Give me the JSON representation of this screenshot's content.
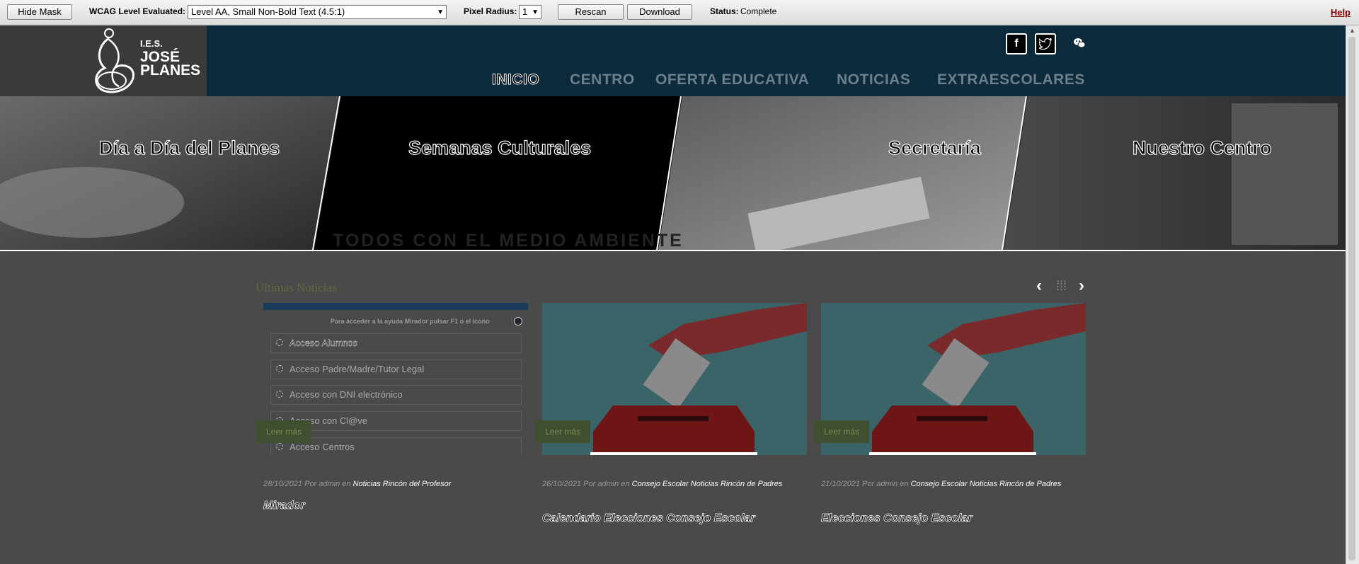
{
  "toolbar": {
    "hide_mask": "Hide Mask",
    "wcag_label": "WCAG Level Evaluated:",
    "wcag_value": "Level AA, Small Non-Bold Text (4.5:1)",
    "radius_label": "Pixel Radius:",
    "radius_value": "1",
    "rescan": "Rescan",
    "download": "Download",
    "status_label": "Status:",
    "status_value": "Complete",
    "help": "Help"
  },
  "header": {
    "logo_line1": "I.E.S.",
    "logo_line2": "JOSÉ",
    "logo_line3": "PLANES",
    "social": [
      "facebook-icon",
      "twitter-icon",
      "wechat-icon"
    ],
    "nav": [
      "INICIO",
      "CENTRO",
      "OFERTA EDUCATIVA",
      "NOTICIAS",
      "EXTRAESCOLARES"
    ]
  },
  "banner": {
    "panels": [
      "Día a Día del Planes",
      "Semanas Culturales",
      "Secretaría",
      "Nuestro Centro"
    ],
    "overlay_text": "TODOS CON EL MEDIO AMBIENTE"
  },
  "news": {
    "title": "Últimas Noticias",
    "login_help": "Para acceder a la ayuda Mirador pulsar F1 o el icono",
    "login_items": [
      "Acceso Alumnos",
      "Acceso Padre/Madre/Tutor Legal",
      "Acceso con DNI electrónico",
      "Acceso con Cl@ve",
      "Acceso Centros"
    ],
    "read_more": "Leer más",
    "cards": [
      {
        "meta": "28/10/2021 Por admin en",
        "categories": "Noticias Rincón del Profesor",
        "title": "Mirador"
      },
      {
        "meta": "26/10/2021 Por admin en",
        "categories": "Consejo Escolar Noticias Rincón de Padres",
        "title": "Calendario Elecciones Consejo Escolar"
      },
      {
        "meta": "21/10/2021 Por admin en",
        "categories": "Consejo Escolar Noticias Rincón de Padres",
        "title": "Elecciones Consejo Escolar"
      }
    ]
  },
  "colors": {
    "header_bg": "#0b2a3c",
    "nav_inactive": "#6d7f8a",
    "page_bg": "#4a4a4a",
    "vote_bg": "#3a6468",
    "ballot_box": "#6e1616"
  }
}
